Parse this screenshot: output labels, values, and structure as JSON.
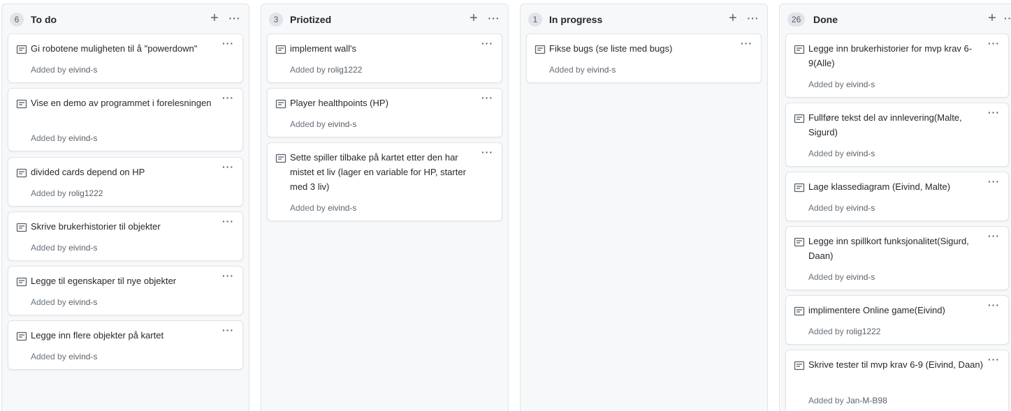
{
  "columns": [
    {
      "count": "6",
      "title": "To do",
      "add_icon": "plus-icon",
      "menu_icon": "kebab-horizontal-icon",
      "cards": [
        {
          "title": "Gi robotene muligheten til å \"powerdown\"",
          "added_by_label": "Added by",
          "user": "eivind-s"
        },
        {
          "title": "Vise en demo av programmet i forelesningen",
          "added_by_label": "Added by",
          "user": "eivind-s"
        },
        {
          "title": "divided cards depend on HP",
          "added_by_label": "Added by",
          "user": "rolig1222"
        },
        {
          "title": "Skrive brukerhistorier til objekter",
          "added_by_label": "Added by",
          "user": "eivind-s"
        },
        {
          "title": "Legge til egenskaper til nye objekter",
          "added_by_label": "Added by",
          "user": "eivind-s"
        },
        {
          "title": "Legge inn flere objekter på kartet",
          "added_by_label": "Added by",
          "user": "eivind-s"
        }
      ]
    },
    {
      "count": "3",
      "title": "Priotized",
      "add_icon": "plus-icon",
      "menu_icon": "kebab-horizontal-icon",
      "cards": [
        {
          "title": "implement wall's",
          "added_by_label": "Added by",
          "user": "rolig1222"
        },
        {
          "title": "Player healthpoints (HP)",
          "added_by_label": "Added by",
          "user": "eivind-s"
        },
        {
          "title": "Sette spiller tilbake på kartet etter den har mistet et liv (lager en variable for HP, starter med 3 liv)",
          "added_by_label": "Added by",
          "user": "eivind-s"
        }
      ]
    },
    {
      "count": "1",
      "title": "In progress",
      "add_icon": "plus-icon",
      "menu_icon": "kebab-horizontal-icon",
      "cards": [
        {
          "title": "Fikse bugs (se liste med bugs)",
          "added_by_label": "Added by",
          "user": "eivind-s"
        }
      ]
    },
    {
      "count": "26",
      "title": "Done",
      "add_icon": "plus-icon",
      "menu_icon": "kebab-horizontal-icon",
      "cards": [
        {
          "title": "Legge inn brukerhistorier for mvp krav 6-9(Alle)",
          "added_by_label": "Added by",
          "user": "eivind-s"
        },
        {
          "title": "Fullføre tekst del av innlevering(Malte, Sigurd)",
          "added_by_label": "Added by",
          "user": "eivind-s"
        },
        {
          "title": "Lage klassediagram (Eivind, Malte)",
          "added_by_label": "Added by",
          "user": "eivind-s"
        },
        {
          "title": "Legge inn spillkort funksjonalitet(Sigurd, Daan)",
          "added_by_label": "Added by",
          "user": "eivind-s"
        },
        {
          "title": "implimentere Online game(Eivind)",
          "added_by_label": "Added by",
          "user": "rolig1222"
        },
        {
          "title": "Skrive tester til mvp krav 6-9 (Eivind, Daan)",
          "added_by_label": "Added by",
          "user": "Jan-M-B98"
        }
      ]
    }
  ],
  "card_icon": "note-icon",
  "card_menu_icon": "kebab-horizontal-icon",
  "colors": {
    "column_bg": "#f6f8fa",
    "border": "#e1e4e8",
    "text": "#24292e",
    "muted": "#6a737d"
  }
}
